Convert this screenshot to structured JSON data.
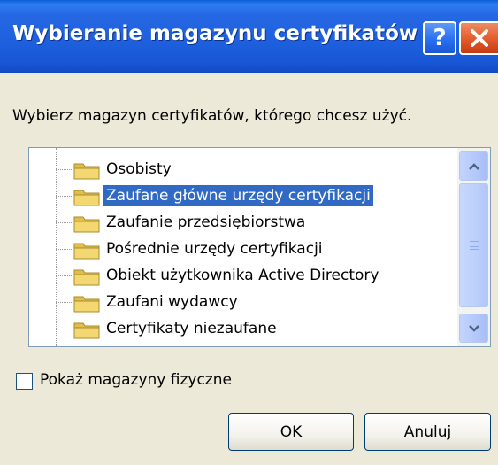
{
  "dialog": {
    "title": "Wybieranie magazynu certyfikatów",
    "help_glyph": "?",
    "instruction": "Wybierz magazyn certyfikatów, którego chcesz użyć."
  },
  "tree": {
    "items": [
      {
        "label": "Osobisty",
        "icon": "folder-icon",
        "selected": false
      },
      {
        "label": "Zaufane główne urzędy certyfikacji",
        "icon": "folder-icon",
        "selected": true
      },
      {
        "label": "Zaufanie przedsiębiorstwa",
        "icon": "folder-icon",
        "selected": false
      },
      {
        "label": "Pośrednie urzędy certyfikacji",
        "icon": "folder-icon",
        "selected": false
      },
      {
        "label": "Obiekt użytkownika Active Directory",
        "icon": "folder-icon",
        "selected": false
      },
      {
        "label": "Zaufani wydawcy",
        "icon": "folder-icon",
        "selected": false
      },
      {
        "label": "Certyfikaty niezaufane",
        "icon": "folder-icon",
        "selected": false
      }
    ]
  },
  "options": {
    "show_physical_label": "Pokaż magazyny fizyczne",
    "show_physical_checked": false
  },
  "buttons": {
    "ok": "OK",
    "cancel": "Anuluj"
  },
  "colors": {
    "titlebar": "#1d5fdc",
    "selection": "#316ac5",
    "dialog_bg": "#ece9d8",
    "close_button": "#e35a2a",
    "folder": "#f3d872"
  }
}
